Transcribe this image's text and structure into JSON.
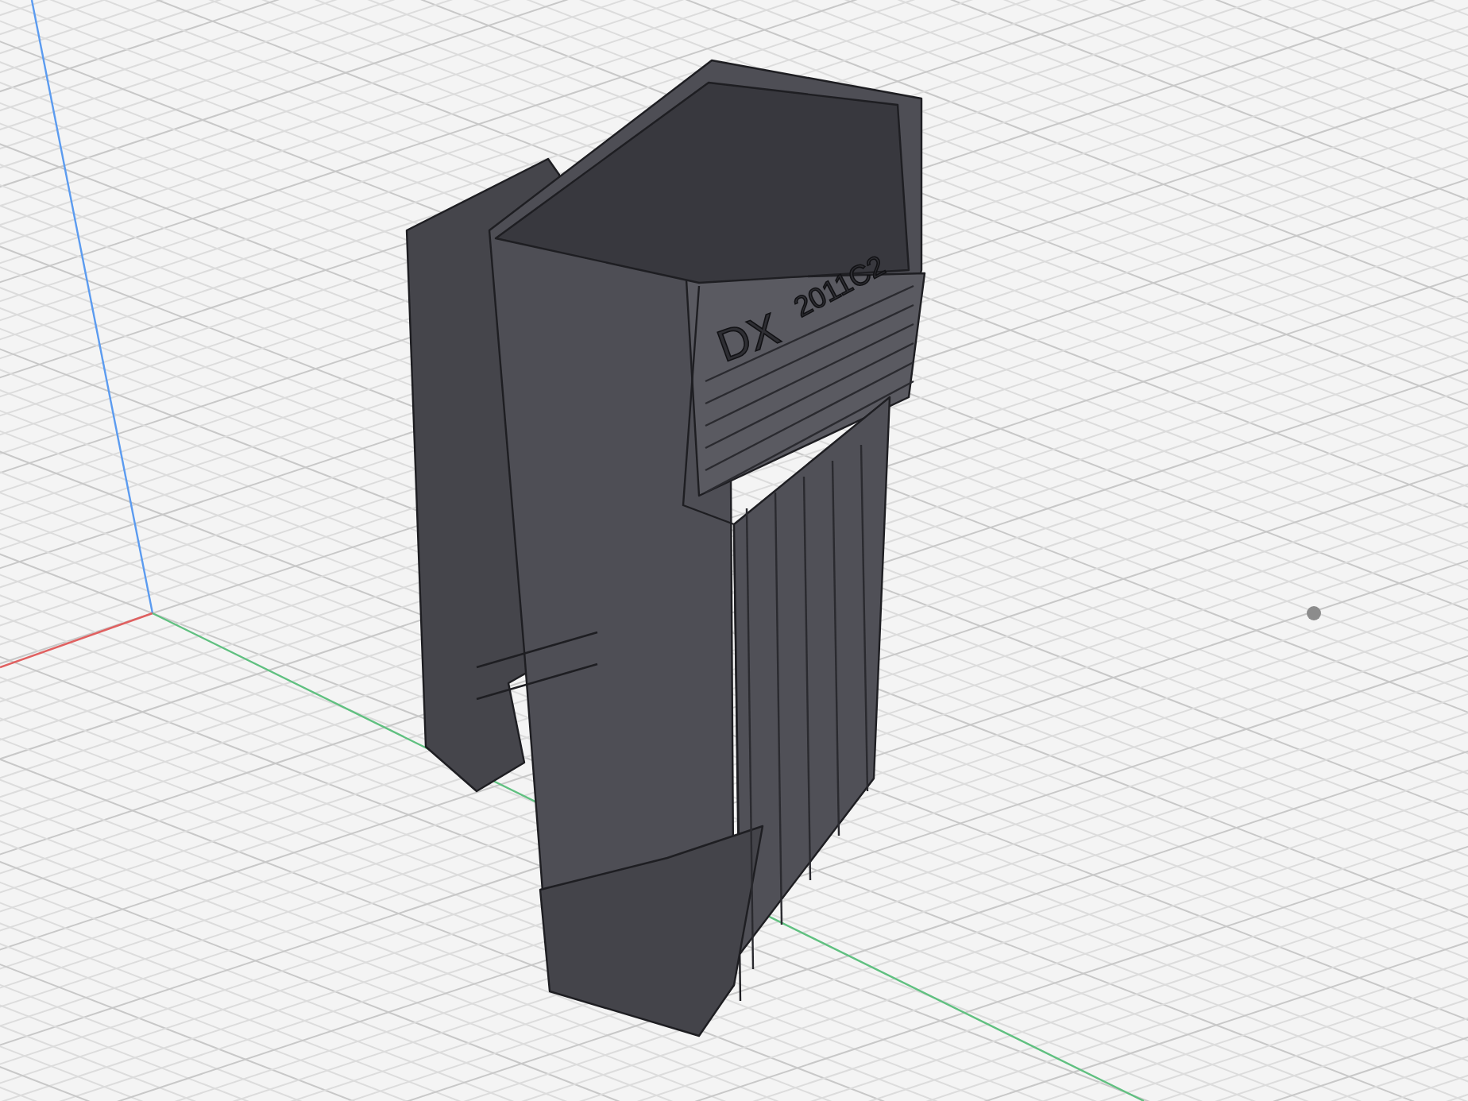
{
  "viewport": {
    "model": {
      "engravings": [
        {
          "text": "DX"
        },
        {
          "text": "2011C2"
        }
      ]
    }
  }
}
